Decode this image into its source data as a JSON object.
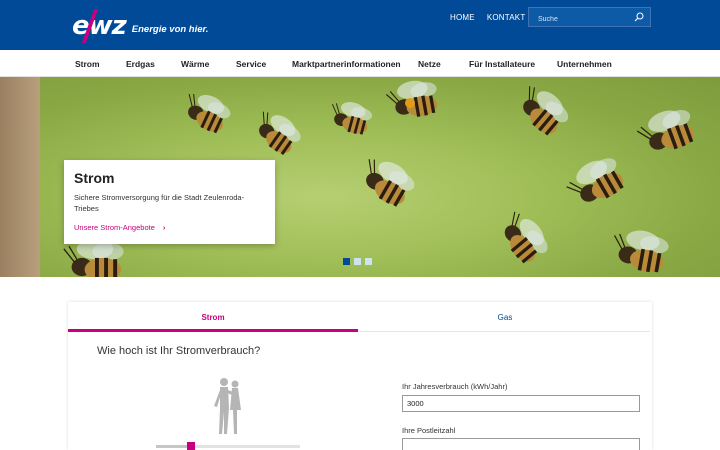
{
  "brand": {
    "logo_text": "ewz",
    "tagline": "Energie von hier."
  },
  "topnav": {
    "home": "HOME",
    "contact": "KONTAKT"
  },
  "search": {
    "placeholder": "Suche"
  },
  "mainnav": [
    "Strom",
    "Erdgas",
    "Wärme",
    "Service",
    "Marktpartnerinformationen",
    "Netze",
    "Für Installateure",
    "Unternehmen"
  ],
  "hero": {
    "title": "Strom",
    "text": "Sichere Stromversorgung für die Stadt Zeulenroda-Triebes",
    "link": "Unsere Strom-Angebote",
    "chevron": "›",
    "slide_count": 3,
    "active_slide": 1
  },
  "calculator": {
    "tabs": [
      "Strom",
      "Gas"
    ],
    "active_tab": "Strom",
    "question": "Wie hoch ist Ihr Stromverbrauch?",
    "consumption_label": "Ihr Jahresverbrauch (kWh/Jahr)",
    "consumption_value": "3000",
    "postcode_label": "Ihre Postleitzahl",
    "postcode_value": ""
  },
  "colors": {
    "brand_blue": "#004a98",
    "accent_magenta": "#c6007e"
  }
}
